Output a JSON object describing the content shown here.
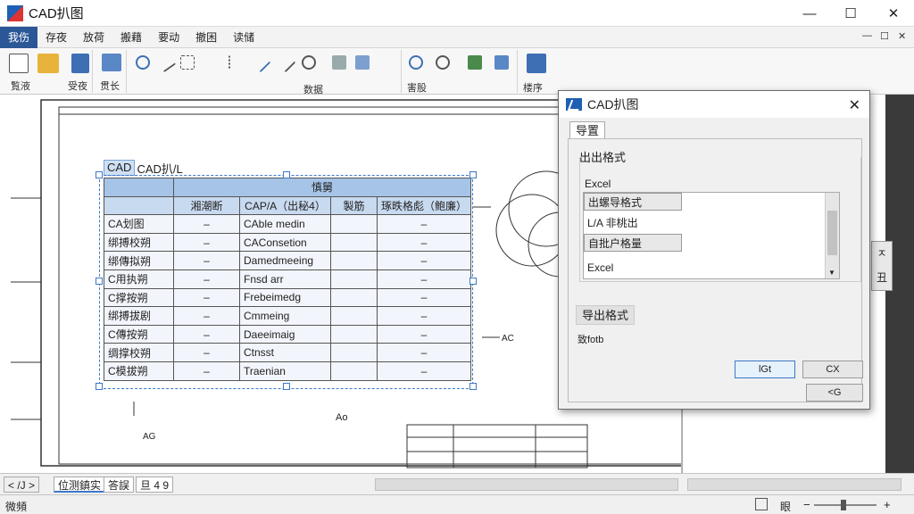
{
  "window": {
    "title": "CAD扒图",
    "minimize": "—",
    "maximize": "☐",
    "close": "✕"
  },
  "menu": {
    "items": [
      "我伤",
      "存夜",
      "放荷",
      "搬藉",
      "要动",
      "撤困",
      "读储"
    ],
    "mdi": [
      "—",
      "☐",
      "✕"
    ]
  },
  "ribbon": {
    "group1_labels": [
      "覧液",
      "受夜"
    ],
    "group2_label": "贯长",
    "group3_label": "数据",
    "group4_label": "害股",
    "group5_label": "楼序"
  },
  "drawing": {
    "cad_label_a": "CAD",
    "cad_label_b": "CAD扒/L",
    "table": {
      "title": "慎舅",
      "headers": [
        "湘潮断",
        "CAP/A（出秘4）",
        "製筋",
        "琢昳格彪（鲍廉）"
      ],
      "rows": [
        [
          "CA划图",
          "–",
          "CAble medin",
          "–"
        ],
        [
          "绑搏校朔",
          "–",
          "CAConsetion",
          "–"
        ],
        [
          "绑傳拟朔",
          "–",
          "Damedmeeing",
          "–"
        ],
        [
          "C用执朔",
          "–",
          "Fnsd arr",
          "–"
        ],
        [
          "C撑按朔",
          "–",
          "Frebeimedg",
          "–"
        ],
        [
          "绑搏拔剧",
          "–",
          "Cmmeing",
          "–"
        ],
        [
          "C傳按朔",
          "–",
          "Daeeimaig",
          "–"
        ],
        [
          "绸撑校朔",
          "–",
          "Ctnsst",
          "–"
        ],
        [
          "C模拔朔",
          "–",
          "Traenian",
          "–"
        ]
      ]
    },
    "annot_right": "AC",
    "annot_mid": "Ao",
    "annot_left": "AG"
  },
  "dialog": {
    "title": "CAD扒图",
    "close": "✕",
    "tab": "导置",
    "group_title": "出出格式",
    "excel_top": "Excel",
    "list_items": [
      "出螺导格式",
      "L/A 非桃出",
      "自批户格量",
      "Excel"
    ],
    "export_button": "导出格式",
    "status_text": "致fotb",
    "ok_button": "lGt",
    "cancel_button": "CX",
    "help_button": "<G",
    "right_buttons": [
      "ㅈ",
      "丑"
    ]
  },
  "sheetbar": {
    "nav": "< /J >",
    "tabs": [
      "位测鎮实",
      "答誤",
      "旦 4 9"
    ]
  },
  "status": {
    "left": "微頻",
    "right_label": "眼"
  }
}
